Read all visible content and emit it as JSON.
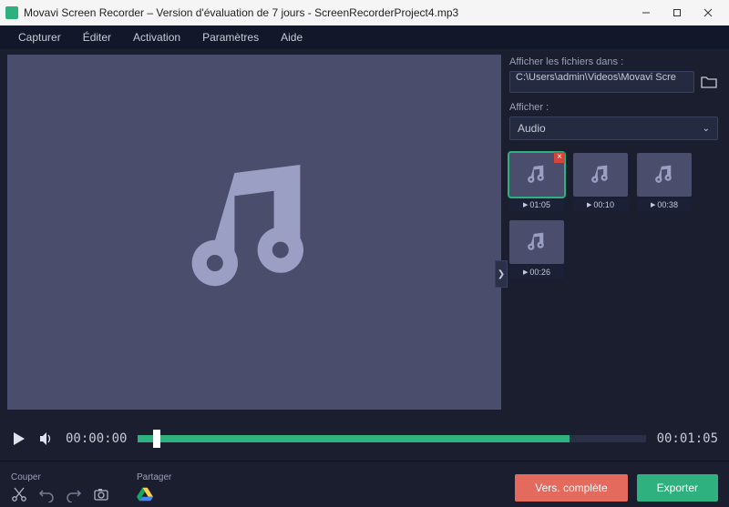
{
  "window": {
    "title": "Movavi Screen Recorder – Version d'évaluation de 7 jours - ScreenRecorderProject4.mp3"
  },
  "menu": {
    "capture": "Capturer",
    "edit": "Éditer",
    "activation": "Activation",
    "settings": "Paramètres",
    "help": "Aide"
  },
  "side": {
    "show_files_label": "Afficher les fichiers dans :",
    "path": "C:\\Users\\admin\\Videos\\Movavi Scre",
    "show_label": "Afficher :",
    "filter": "Audio"
  },
  "thumbs": [
    {
      "duration": "01:05",
      "selected": true,
      "deletable": true
    },
    {
      "duration": "00:10",
      "selected": false,
      "deletable": false
    },
    {
      "duration": "00:38",
      "selected": false,
      "deletable": false
    },
    {
      "duration": "00:26",
      "selected": false,
      "deletable": false
    }
  ],
  "playback": {
    "current": "00:00:00",
    "total": "00:01:05"
  },
  "bottom": {
    "cut_label": "Couper",
    "share_label": "Partager",
    "demo_button": "Vers. complète",
    "export_button": "Exporter"
  }
}
